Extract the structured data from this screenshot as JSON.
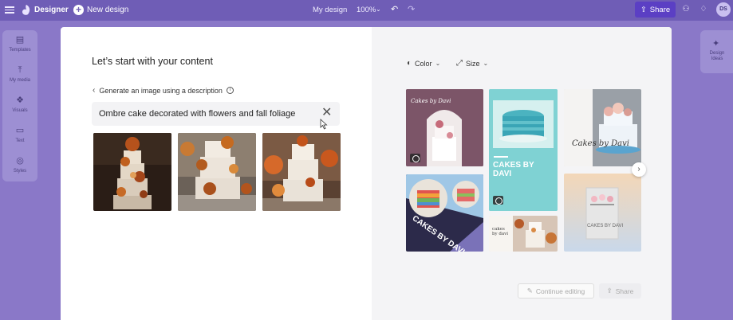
{
  "app": {
    "brand": "Designer",
    "new_design_label": "New design",
    "doc_name": "My design",
    "zoom": "100%",
    "share_label": "Share",
    "avatar_initials": "DS"
  },
  "left_rail": [
    {
      "label": "Templates",
      "icon": "templates-icon",
      "glyph": "▤"
    },
    {
      "label": "My media",
      "icon": "upload-icon",
      "glyph": "⤒"
    },
    {
      "label": "Visuals",
      "icon": "visuals-icon",
      "glyph": "❖"
    },
    {
      "label": "Text",
      "icon": "text-icon",
      "glyph": "▭"
    },
    {
      "label": "Styles",
      "icon": "styles-icon",
      "glyph": "◎"
    }
  ],
  "right_rail": {
    "label": "Design Ideas",
    "icon": "design-ideas-icon"
  },
  "modal": {
    "heading": "Let’s start with your content",
    "back_link": "Generate an image using a description",
    "prompt": "Ombre cake decorated with flowers and fall foliage",
    "filters": {
      "color_label": "Color",
      "size_label": "Size"
    },
    "templates": {
      "t1_text": "Cakes by Davi",
      "t2_text": "CAKES BY DAVI",
      "t3_text": "Cakes by Davi",
      "t4_text": "CAKES BY DAVI",
      "t5_text": "cakes by davi",
      "t6_text": "CAKES BY DAVI"
    },
    "continue_label": "Continue editing",
    "share_label": "Share"
  }
}
